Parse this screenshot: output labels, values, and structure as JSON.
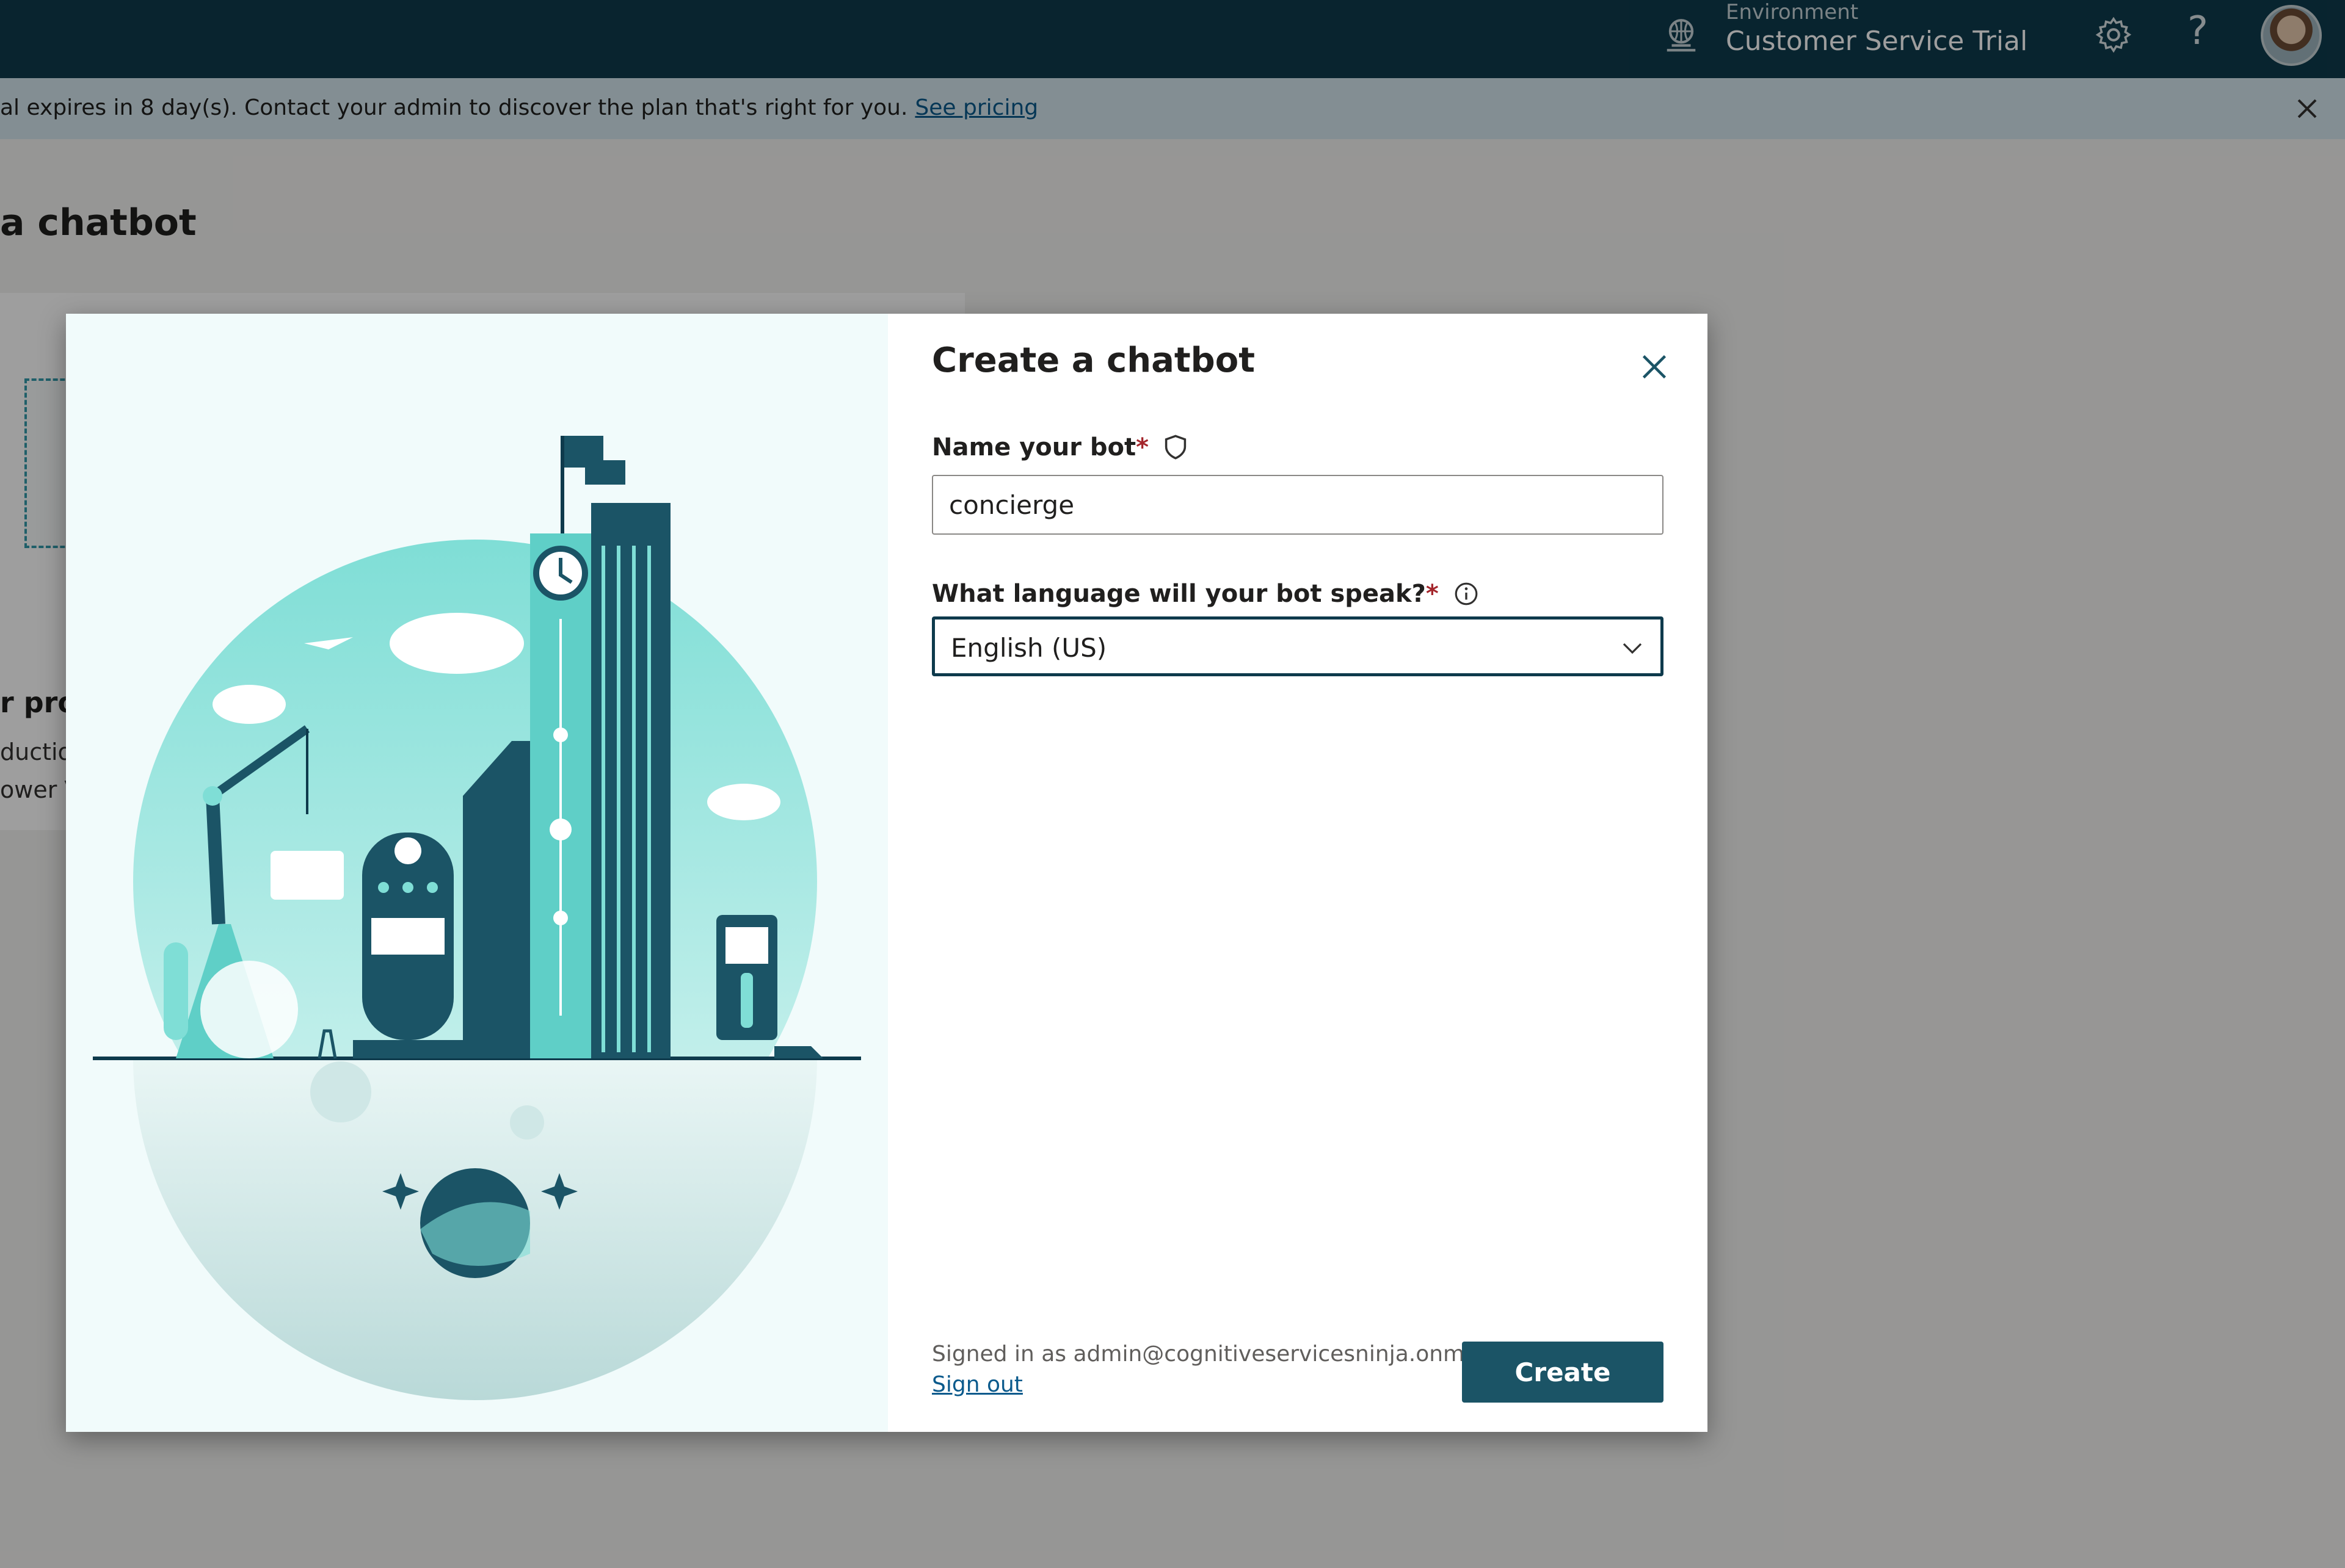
{
  "topbar": {
    "environment_label": "Environment",
    "environment_name": "Customer Service Trial",
    "icons": [
      "environment-icon",
      "settings-icon",
      "help-icon",
      "avatar"
    ],
    "background": "#0e3a4c"
  },
  "banner": {
    "text": "al expires in 8 day(s). Contact your admin to discover the plan that's right for you.",
    "link_text": "See pricing"
  },
  "page": {
    "title": "a chatbot",
    "card": {
      "title": "r pro",
      "line1": "ductio",
      "line2": "ower V"
    }
  },
  "modal": {
    "title": "Create a chatbot",
    "name_field": {
      "label": "Name your bot",
      "required_mark": "*",
      "value": "concierge"
    },
    "language_field": {
      "label": "What language will your bot speak?",
      "required_mark": "*",
      "selected": "English (US)"
    },
    "footer": {
      "signed_in_text": "Signed in as admin@cognitiveservicesninja.onmic...",
      "sign_out": "Sign out",
      "create_label": "Create"
    },
    "accent_color": "#1b5466"
  }
}
